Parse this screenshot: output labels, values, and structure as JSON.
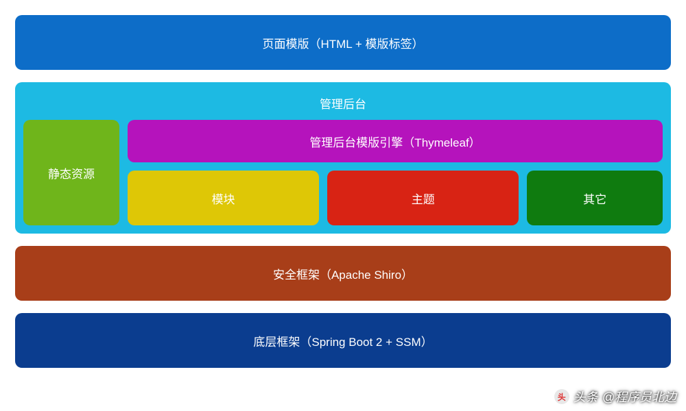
{
  "layers": {
    "template": "页面模版（HTML + 模版标签）",
    "admin": {
      "title": "管理后台",
      "static_resources": "静态资源",
      "template_engine": "管理后台模版引擎（Thymeleaf）",
      "sub": {
        "module": "模块",
        "theme": "主题",
        "other": "其它"
      }
    },
    "security": "安全框架（Apache Shiro）",
    "base": "底层框架（Spring Boot 2 + SSM）"
  },
  "watermark": {
    "prefix": "头条",
    "author": "@程序员北边"
  },
  "colors": {
    "template": "#0d6dc8",
    "admin_container": "#1dbae3",
    "static_resources": "#6fb51b",
    "template_engine": "#b513bc",
    "module": "#dec706",
    "theme": "#d82314",
    "other": "#0f7b0f",
    "security": "#a83e19",
    "base": "#0b3d8f"
  }
}
